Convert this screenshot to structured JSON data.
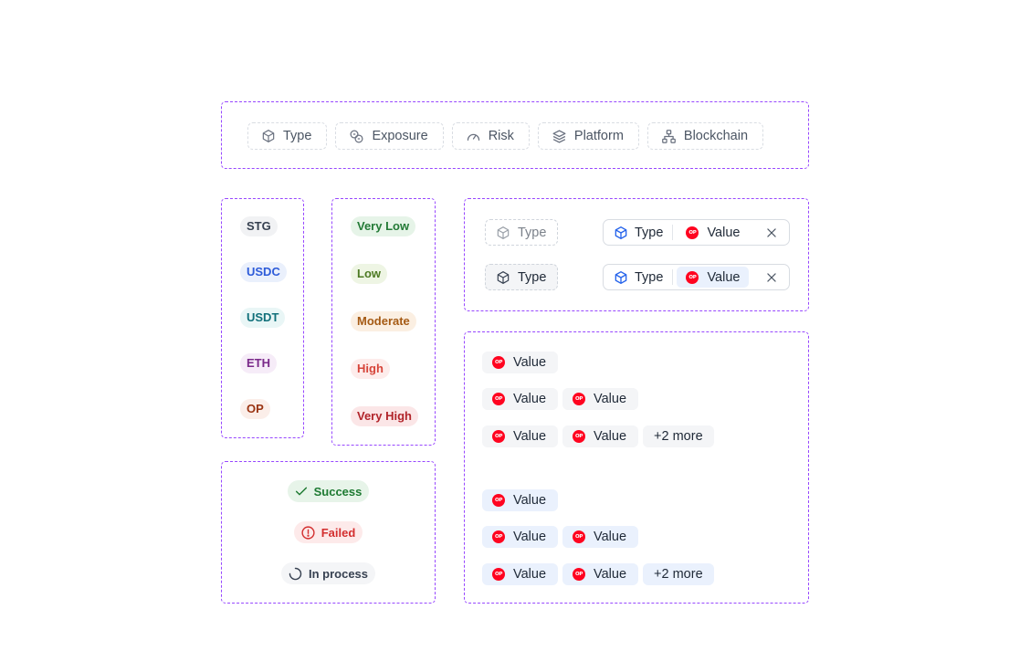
{
  "colors": {
    "frame_border": "#9747ff",
    "blue_icon": "#2563eb",
    "op_red": "#ff0420"
  },
  "filters": [
    {
      "label": "Type",
      "icon": "cube-icon"
    },
    {
      "label": "Exposure",
      "icon": "coins-icon"
    },
    {
      "label": "Risk",
      "icon": "gauge-icon"
    },
    {
      "label": "Platform",
      "icon": "layers-icon"
    },
    {
      "label": "Blockchain",
      "icon": "network-icon"
    }
  ],
  "tokens": [
    {
      "label": "STG",
      "color": "#374151",
      "bg": "#f1f2f4"
    },
    {
      "label": "USDC",
      "color": "#2d5bd9",
      "bg": "#eaf0fc"
    },
    {
      "label": "USDT",
      "color": "#11707a",
      "bg": "#e9f6f6"
    },
    {
      "label": "ETH",
      "color": "#7a2a8a",
      "bg": "#f6ecf8"
    },
    {
      "label": "OP",
      "color": "#9a3412",
      "bg": "#fbeee9"
    }
  ],
  "risks": [
    {
      "label": "Very Low",
      "color": "#237a36",
      "bg": "#e6f4e8"
    },
    {
      "label": "Low",
      "color": "#4d7a23",
      "bg": "#eef5e4"
    },
    {
      "label": "Moderate",
      "color": "#a55a14",
      "bg": "#fbefe2"
    },
    {
      "label": "High",
      "color": "#d6453a",
      "bg": "#fdeceb"
    },
    {
      "label": "Very High",
      "color": "#b1242a",
      "bg": "#fbe6e7"
    }
  ],
  "statuses": [
    {
      "label": "Success",
      "icon": "check-icon",
      "color": "#1e7a32",
      "bg": "#e7f4e9"
    },
    {
      "label": "Failed",
      "icon": "alert-circle-icon",
      "color": "#d32f2f",
      "bg": "#fdeaea"
    },
    {
      "label": "In process",
      "icon": "spinner-icon",
      "color": "#374151",
      "bg": "#f4f5f7"
    }
  ],
  "selectors": {
    "type_placeholder": "Type",
    "type_active": "Type",
    "combo_type": "Type",
    "combo_value": "Value"
  },
  "value_chip": {
    "label": "Value",
    "more_label": "+2 more",
    "op_icon_text": "OP"
  }
}
